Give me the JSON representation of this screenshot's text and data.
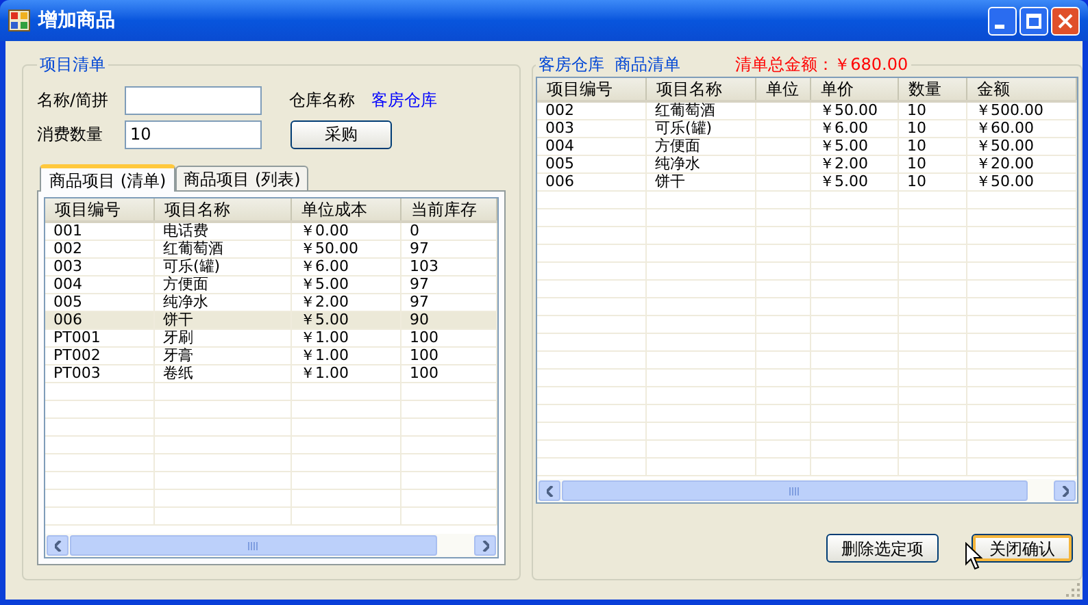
{
  "window": {
    "title": "增加商品"
  },
  "item_list": {
    "title": "项目清单",
    "name_field": {
      "label": "名称/简拼"
    },
    "quantity_field": {
      "label": "消费数量",
      "value": "10"
    },
    "warehouse_label": "仓库名称",
    "warehouse_value": "客房仓库",
    "purchase_button": "采购",
    "tabs": [
      {
        "label": "商品项目 (清单)",
        "selected": true
      },
      {
        "label": "商品项目 (列表)",
        "selected": false
      }
    ],
    "table": {
      "columns": [
        "项目编号",
        "项目名称",
        "单位成本",
        "当前库存"
      ],
      "rows": [
        {
          "cells": [
            "001",
            "电话费",
            "￥0.00",
            "0"
          ],
          "selected": false
        },
        {
          "cells": [
            "002",
            "红葡萄酒",
            "￥50.00",
            "97"
          ],
          "selected": false
        },
        {
          "cells": [
            "003",
            "可乐(罐)",
            "￥6.00",
            "103"
          ],
          "selected": false
        },
        {
          "cells": [
            "004",
            "方便面",
            "￥5.00",
            "97"
          ],
          "selected": false
        },
        {
          "cells": [
            "005",
            "纯净水",
            "￥2.00",
            "97"
          ],
          "selected": false
        },
        {
          "cells": [
            "006",
            "饼干",
            "￥5.00",
            "90"
          ],
          "selected": true
        },
        {
          "cells": [
            "PT001",
            "牙刷",
            "￥1.00",
            "100"
          ],
          "selected": false
        },
        {
          "cells": [
            "PT002",
            "牙膏",
            "￥1.00",
            "100"
          ],
          "selected": false
        },
        {
          "cells": [
            "PT003",
            "卷纸",
            "￥1.00",
            "100"
          ],
          "selected": false
        }
      ]
    }
  },
  "order_list": {
    "title": "客房仓库  商品清单",
    "total": "清单总金额：￥680.00",
    "table": {
      "columns": [
        "项目编号",
        "项目名称",
        "单位",
        "单价",
        "数量",
        "金额"
      ],
      "rows": [
        {
          "cells": [
            "002",
            "红葡萄酒",
            "",
            "￥50.00",
            "10",
            "￥500.00"
          ],
          "selected": false
        },
        {
          "cells": [
            "003",
            "可乐(罐)",
            "",
            "￥6.00",
            "10",
            "￥60.00"
          ],
          "selected": false
        },
        {
          "cells": [
            "004",
            "方便面",
            "",
            "￥5.00",
            "10",
            "￥50.00"
          ],
          "selected": false
        },
        {
          "cells": [
            "005",
            "纯净水",
            "",
            "￥2.00",
            "10",
            "￥20.00"
          ],
          "selected": false
        },
        {
          "cells": [
            "006",
            "饼干",
            "",
            "￥5.00",
            "10",
            "￥50.00"
          ],
          "selected": false
        }
      ]
    }
  },
  "buttons": [
    {
      "label": "删除选定项",
      "default": false
    },
    {
      "label": "关闭确认",
      "default": true
    }
  ]
}
